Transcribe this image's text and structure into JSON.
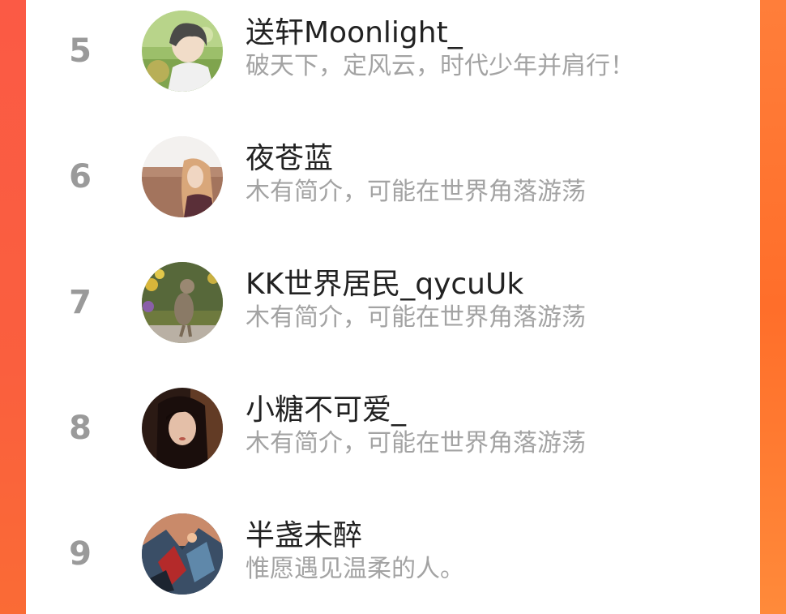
{
  "ranking": {
    "items": [
      {
        "rank": "5",
        "name": "送轩Moonlight_",
        "bio": "破天下，定风云，时代少年并肩行！",
        "avatar": "avatar-boy-photo"
      },
      {
        "rank": "6",
        "name": "夜苍蓝",
        "bio": "木有简介，可能在世界角落游荡",
        "avatar": "avatar-girl-field-photo"
      },
      {
        "rank": "7",
        "name": "KK世界居民_qycuUk",
        "bio": "木有简介，可能在世界角落游荡",
        "avatar": "avatar-cat-photo"
      },
      {
        "rank": "8",
        "name": "小糖不可爱_",
        "bio": "木有简介，可能在世界角落游荡",
        "avatar": "avatar-girl-portrait-photo"
      },
      {
        "rank": "9",
        "name": "半盏未醉",
        "bio": "惟愿遇见温柔的人。",
        "avatar": "avatar-anime-art"
      }
    ]
  },
  "colors": {
    "frame_left": "#fb5a45",
    "frame_right": "#ff7e3a",
    "rank_number": "#9a9a9a",
    "name_text": "#222222",
    "bio_text": "#a3a3a3"
  }
}
